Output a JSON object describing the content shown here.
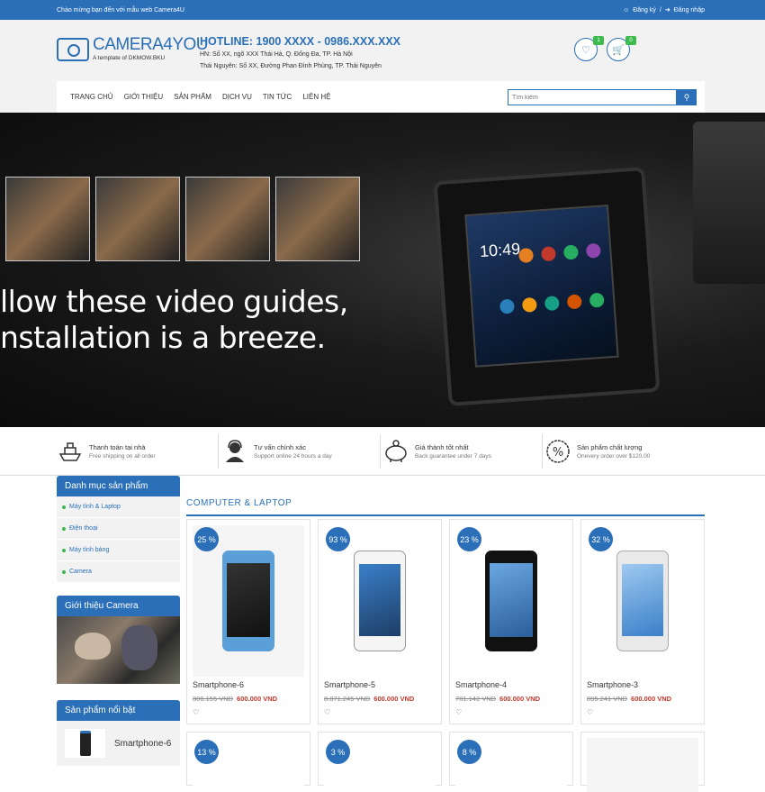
{
  "topbar": {
    "welcome": "Chào mừng bạn đến với mẫu web Camera4U",
    "register": "Đăng ký",
    "separator": "/",
    "login": "Đăng nhập"
  },
  "header": {
    "brand": "CAMERA4YOU",
    "tagline": "A template of DKMOW.BKU",
    "hotline": "HOTLINE: 1900 XXXX - 0986.XXX.XXX",
    "address1": "HN: Số XX, ngõ XXX Thái Hà, Q. Đống Đa, TP. Hà Nội",
    "address2": "Thái Nguyên: Số XX, Đường Phan Đình Phùng, TP. Thái Nguyên",
    "wishlist_count": "1",
    "cart_count": "0"
  },
  "nav": {
    "items": [
      "Trang chủ",
      "Giới thiệu",
      "Sản phẩm",
      "Dịch vụ",
      "Tin tức",
      "Liên hệ"
    ],
    "search_placeholder": "Tìm kiếm"
  },
  "banner": {
    "line1": "llow these video guides,",
    "line2": "nstallation is a breeze.",
    "time": "10:49"
  },
  "features": [
    {
      "title": "Thanh toán tại nhà",
      "sub": "Free shipping on all order",
      "icon": "ship-icon"
    },
    {
      "title": "Tư vấn chính xác",
      "sub": "Support online 24 hours a day",
      "icon": "support-agent-icon"
    },
    {
      "title": "Giá thành tốt nhất",
      "sub": "Back guarantee under 7 days",
      "icon": "piggy-bank-icon"
    },
    {
      "title": "Sản phẩm chất lượng",
      "sub": "Onevery order over $120.00",
      "icon": "percent-badge-icon"
    }
  ],
  "sidebar": {
    "categories_title": "Danh mục sản phẩm",
    "categories": [
      "Máy tính & Laptop",
      "Điện thoại",
      "Máy tính bảng",
      "Camera"
    ],
    "intro_title": "Giới thiệu Camera",
    "featured_title": "Sản phẩm nổi bật",
    "featured_item": "Smartphone-6"
  },
  "products": {
    "section_title": "COMPUTER & LAPTOP",
    "items": [
      {
        "discount": "25 %",
        "name": "Smartphone-6",
        "old": "806.155 VND",
        "new": "600.000 VND"
      },
      {
        "discount": "93 %",
        "name": "Smartphone-5",
        "old": "8.871.245 VND",
        "new": "600.000 VND"
      },
      {
        "discount": "23 %",
        "name": "Smartphone-4",
        "old": "781.142 VND",
        "new": "600.000 VND"
      },
      {
        "discount": "32 %",
        "name": "Smartphone-3",
        "old": "895.241 VND",
        "new": "600.000 VND"
      }
    ],
    "row2_discounts": [
      "13 %",
      "3 %",
      "8 %"
    ]
  },
  "colors": {
    "accent": "#2a6fb8",
    "badge": "#3dbb4d",
    "price": "#c0392b"
  }
}
